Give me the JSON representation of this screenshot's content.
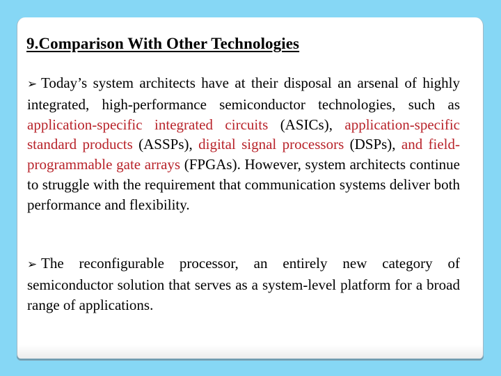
{
  "slide": {
    "title": "9.Comparison With Other Technologies",
    "accent_color": "#B8232A",
    "background_color": "#86D7F5",
    "bullet_icon": "arrow-bullet-icon",
    "bullet_glyph": "➢",
    "bullets": [
      {
        "segments": [
          {
            "text": "Today’s system architects have at their disposal an arsenal of highly integrated, high-performance semiconductor technologies, such as ",
            "highlight": false
          },
          {
            "text": "application-specific integrated circuits",
            "highlight": true
          },
          {
            "text": " (ASICs), ",
            "highlight": false
          },
          {
            "text": "application-specific standard products",
            "highlight": true
          },
          {
            "text": " (ASSPs), ",
            "highlight": false
          },
          {
            "text": "digital signal processors",
            "highlight": true
          },
          {
            "text": " (DSPs), ",
            "highlight": false
          },
          {
            "text": "and field-programmable gate arrays",
            "highlight": true
          },
          {
            "text": " (FPGAs). However, system architects continue to struggle with the requirement that communication systems deliver both performance and flexibility.",
            "highlight": false
          }
        ]
      },
      {
        "segments": [
          {
            "text": "The reconfigurable processor, an entirely new category of semiconductor solution that serves as a system-level platform for a broad range of applications.",
            "highlight": false
          }
        ]
      }
    ]
  }
}
